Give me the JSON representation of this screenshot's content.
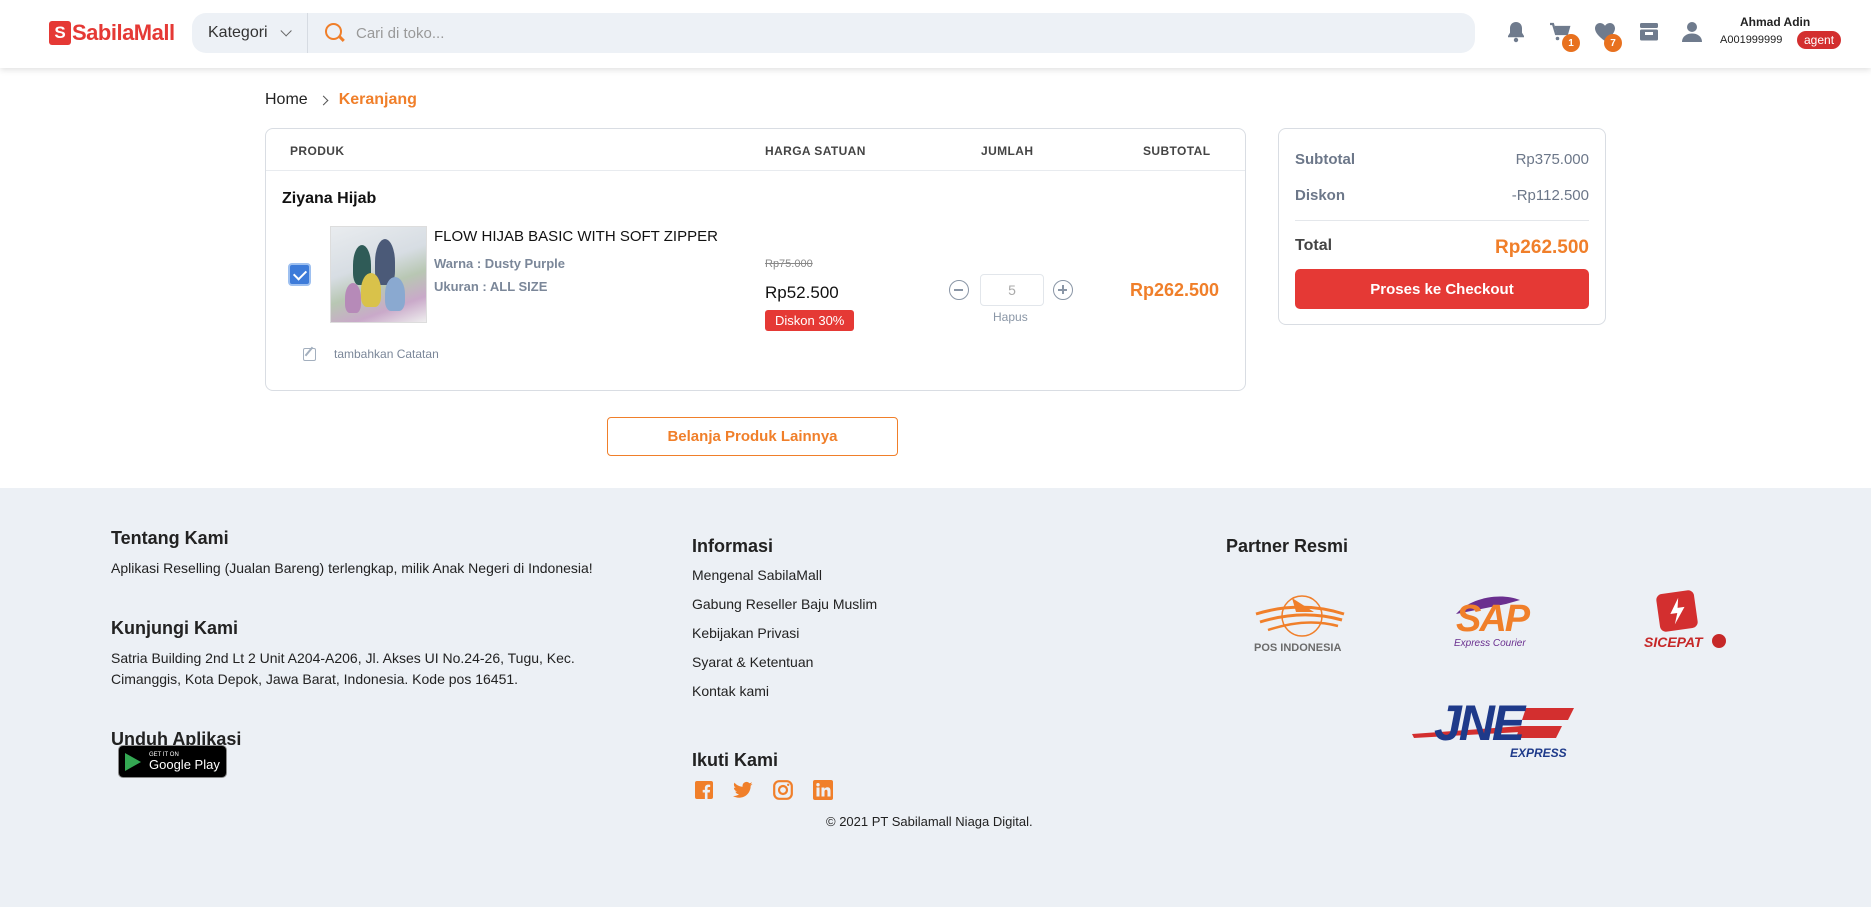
{
  "header": {
    "logo_text": "SabilaMall",
    "logo_mark": "S",
    "category_label": "Kategori",
    "search_placeholder": "Cari di toko...",
    "cart_count": "1",
    "wishlist_count": "7",
    "user_name": "Ahmad Adin",
    "user_id": "A001999999",
    "user_role": "agent",
    "icons": [
      "bell-icon",
      "cart-icon",
      "heart-icon",
      "store-icon",
      "user-icon"
    ]
  },
  "breadcrumb": {
    "home": "Home",
    "current": "Keranjang"
  },
  "cart": {
    "columns": {
      "product": "PRODUK",
      "unit_price": "HARGA SATUAN",
      "quantity": "JUMLAH",
      "subtotal": "SUBTOTAL"
    },
    "shop_name": "Ziyana Hijab",
    "item": {
      "name": "FLOW HIJAB BASIC WITH SOFT ZIPPER",
      "color": "Warna : Dusty Purple",
      "size": "Ukuran : ALL SIZE",
      "price_old": "Rp75.000",
      "price_new": "Rp52.500",
      "discount": "Diskon 30%",
      "quantity": "5",
      "remove_label": "Hapus",
      "subtotal": "Rp262.500",
      "selected": true
    },
    "note_label": "tambahkan Catatan",
    "more_button": "Belanja Produk Lainnya"
  },
  "summary": {
    "subtotal_label": "Subtotal",
    "subtotal_value": "Rp375.000",
    "discount_label": "Diskon",
    "discount_value": "-Rp112.500",
    "total_label": "Total",
    "total_value": "Rp262.500",
    "checkout_button": "Proses ke Checkout"
  },
  "footer": {
    "about_title": "Tentang Kami",
    "about_text": "Aplikasi Reselling (Jualan Bareng) terlengkap, milik Anak Negeri di Indonesia!",
    "visit_title": "Kunjungi Kami",
    "address_line1": "Satria Building 2nd Lt 2 Unit A204-A206, Jl. Akses UI No.24-26, Tugu, Kec.",
    "address_line2": "Cimanggis, Kota Depok, Jawa Barat, Indonesia. Kode pos 16451.",
    "download_title": "Unduh Aplikasi",
    "gplay_small": "GET IT ON",
    "gplay_big": "Google Play",
    "info_title": "Informasi",
    "info_links": [
      "Mengenal SabilaMall",
      "Gabung Reseller Baju Muslim",
      "Kebijakan Privasi",
      "Syarat & Ketentuan",
      "Kontak kami"
    ],
    "follow_title": "Ikuti Kami",
    "social_icons": [
      "facebook-icon",
      "twitter-icon",
      "instagram-icon",
      "linkedin-icon"
    ],
    "copyright": "© 2021 PT Sabilamall Niaga Digital.",
    "partner_title": "Partner Resmi",
    "partners": {
      "pos": "POS INDONESIA",
      "sap": "SAP",
      "sap_sub": "Express Courier",
      "sicepat": "SICEPAT",
      "jne": "JNE",
      "jne_sub": "EXPRESS"
    }
  },
  "colors": {
    "accent": "#f07f2a",
    "brand_red": "#e53935",
    "footer_bg": "#ecf0f5"
  }
}
